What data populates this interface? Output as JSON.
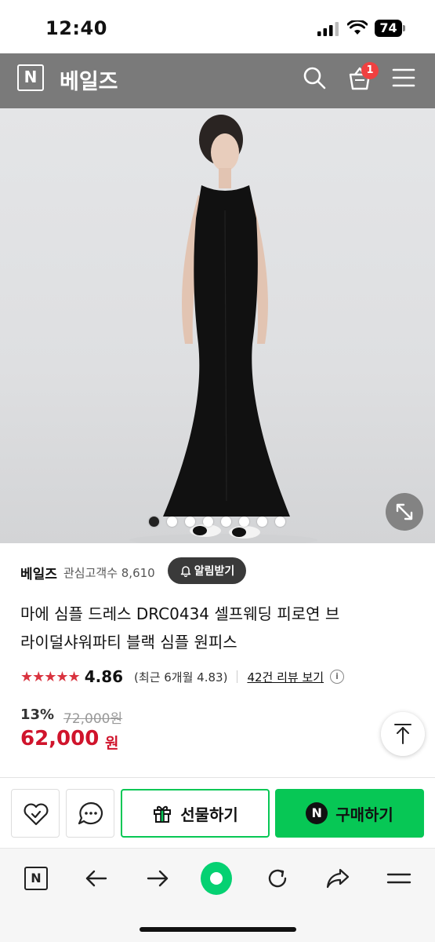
{
  "status": {
    "time": "12:40",
    "battery": "74"
  },
  "header": {
    "logo": "N",
    "store_title": "베일즈",
    "cart_count": "1"
  },
  "image": {
    "slide_count": 8,
    "active_slide": 1
  },
  "store": {
    "name": "베일즈",
    "follower_text": "관심고객수 8,610",
    "notify_label": "알림받기"
  },
  "product": {
    "title_line1": "마에 심플 드레스 DRC0434 셀프웨딩 피로연 브",
    "title_line2": "라이덜샤워파티 블랙 심플 원피스"
  },
  "rating": {
    "stars": "★★★★★",
    "value": "4.86",
    "recent": "(최근 6개월 4.83)",
    "review_link": "42건 리뷰 보기",
    "info": "i"
  },
  "price": {
    "discount": "13%",
    "original": "72,000원",
    "sale": "62,000",
    "unit": "원"
  },
  "actions": {
    "gift_label": "선물하기",
    "buy_label": "구매하기",
    "npay": "N"
  },
  "browser": {
    "home_logo": "N"
  },
  "colors": {
    "accent_green": "#07c755",
    "price_red": "#d0142c",
    "star_red": "#d9333f",
    "header_gray": "#7a7a7a"
  }
}
